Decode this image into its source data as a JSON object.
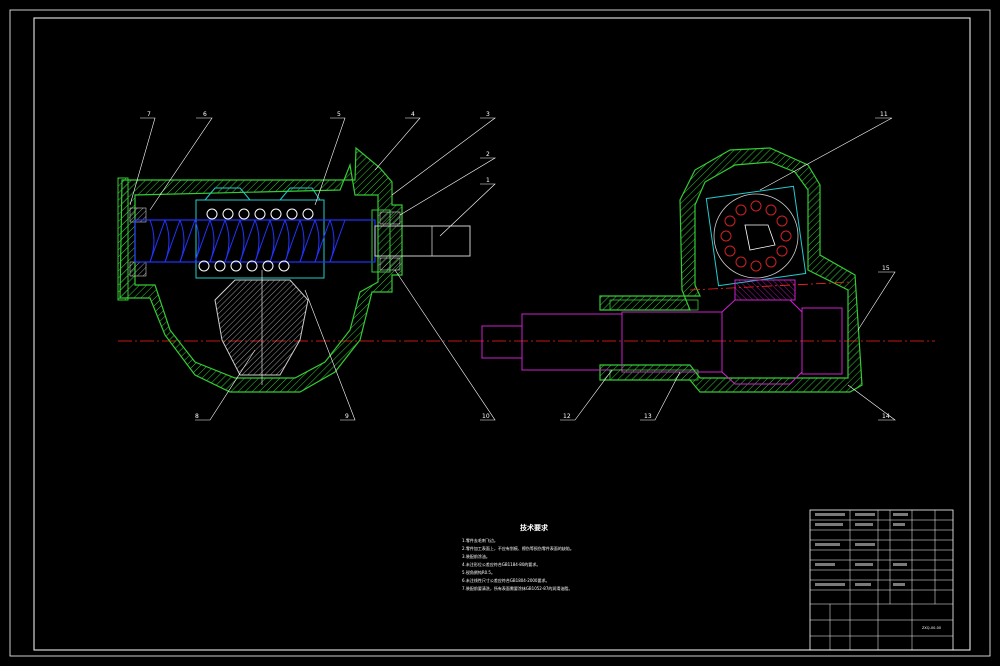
{
  "drawing": {
    "background": "#000000",
    "colors": {
      "frame": "#ffffff",
      "housing": "#33cc33",
      "screw": "#2233ff",
      "cyan_parts": "#22cccc",
      "magenta_parts": "#cc22cc",
      "centerline": "#ff2222",
      "leaders": "#ffffff"
    },
    "part_labels": [
      "7",
      "6",
      "5",
      "4",
      "3",
      "2",
      "1",
      "8",
      "9",
      "10",
      "11",
      "15",
      "12",
      "13",
      "14"
    ],
    "technical_notes": {
      "title": "技术要求",
      "items": [
        "1.零件去毛刺飞边。",
        "2.零件加工表面上，不应有划痕、擦伤等损伤零件表面的缺陷。",
        "3.装配前涂油。",
        "4.未注形位公差应符合GB1184-80的要求。",
        "5.锐角倒钝R0.5。",
        "6.未注线性尺寸公差应符合GB1804-2000要求。",
        "7.装配前要清洗，所有表面需要涂抹GB1052-87的润滑油脂。"
      ]
    },
    "title_block": {
      "part_no": "ZXQ-00-00"
    }
  }
}
